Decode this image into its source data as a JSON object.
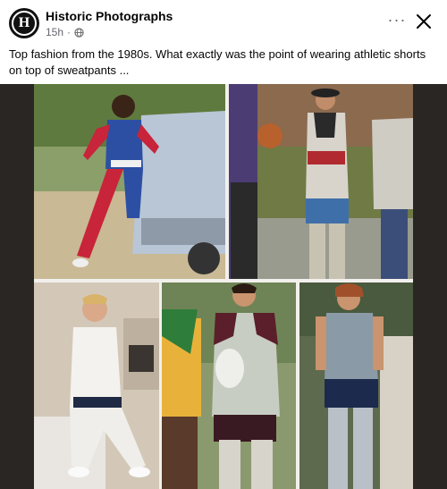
{
  "post": {
    "page_name": "Historic Photographs",
    "avatar_letter": "H",
    "timestamp": "15h",
    "separator": "·",
    "more_label": "···",
    "caption": "Top fashion from the 1980s. What exactly was the point of wearing athletic shorts on top of sweatpants ..."
  },
  "icons": {
    "privacy": "globe-icon",
    "more": "more-horizontal-icon",
    "close": "close-icon"
  },
  "colors": {
    "text_primary": "#050505",
    "text_secondary": "#65676b",
    "collage_background": "#2a2623"
  }
}
